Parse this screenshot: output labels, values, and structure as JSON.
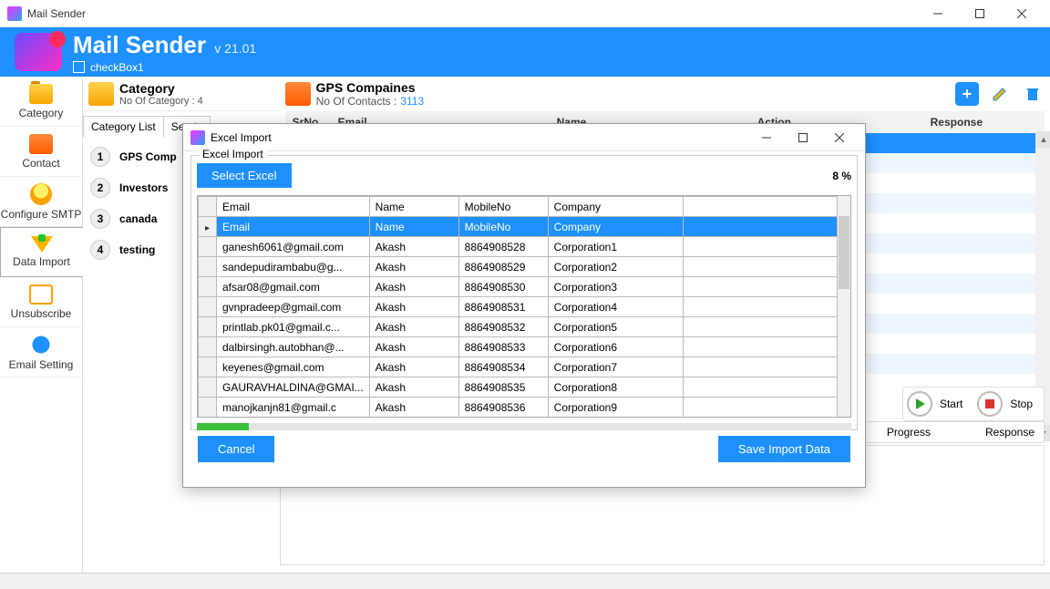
{
  "titlebar": {
    "title": "Mail Sender"
  },
  "header": {
    "brand": "Mail Sender",
    "version": "v 21.01",
    "checkbox_label": "checkBox1"
  },
  "sidenav": {
    "items": [
      {
        "label": "Category"
      },
      {
        "label": "Contact"
      },
      {
        "label": "Configure SMTP"
      },
      {
        "label": "Data Import"
      },
      {
        "label": "Unsubscribe"
      },
      {
        "label": "Email Setting"
      }
    ]
  },
  "midpane": {
    "title": "Category",
    "subtitle": "No Of Category : 4",
    "tabs": [
      {
        "label": "Category List"
      },
      {
        "label": "Sende"
      }
    ],
    "categories": [
      {
        "num": "1",
        "label": "GPS Comp"
      },
      {
        "num": "2",
        "label": "Investors"
      },
      {
        "num": "3",
        "label": "canada"
      },
      {
        "num": "4",
        "label": "testing"
      }
    ]
  },
  "mainpane": {
    "title": "GPS Compaines",
    "subtitle": "No Of Contacts :",
    "count": "3113",
    "cols": {
      "srno": "SrNo",
      "email": "Email",
      "name": "Name",
      "action": "Action",
      "response": "Response"
    },
    "start": "Start",
    "stop": "Stop",
    "progress_col": "Progress",
    "response_col": "Response"
  },
  "modal": {
    "title": "Excel Import",
    "legend": "Excel Import",
    "select_btn": "Select Excel",
    "percent": "8 %",
    "cols": {
      "email": "Email",
      "name": "Name",
      "mobile": "MobileNo",
      "company": "Company"
    },
    "rows": [
      {
        "email": "Email",
        "name": "Name",
        "mobile": "MobileNo",
        "company": "Company"
      },
      {
        "email": "ganesh6061@gmail.com",
        "name": "Akash",
        "mobile": "8864908528",
        "company": "Corporation1"
      },
      {
        "email": "sandepudirambabu@g...",
        "name": "Akash",
        "mobile": "8864908529",
        "company": "Corporation2"
      },
      {
        "email": "afsar08@gmail.com",
        "name": "Akash",
        "mobile": "8864908530",
        "company": "Corporation3"
      },
      {
        "email": "gvnpradeep@gmail.com",
        "name": "Akash",
        "mobile": "8864908531",
        "company": "Corporation4"
      },
      {
        "email": "printlab.pk01@gmail.c...",
        "name": "Akash",
        "mobile": "8864908532",
        "company": "Corporation5"
      },
      {
        "email": "dalbirsingh.autobhan@...",
        "name": "Akash",
        "mobile": "8864908533",
        "company": "Corporation6"
      },
      {
        "email": "keyenes@gmail.com",
        "name": "Akash",
        "mobile": "8864908534",
        "company": "Corporation7"
      },
      {
        "email": "GAURAVHALDINA@GMAI...",
        "name": "Akash",
        "mobile": "8864908535",
        "company": "Corporation8"
      },
      {
        "email": "manojkanjn81@gmail.c",
        "name": "Akash",
        "mobile": "8864908536",
        "company": "Corporation9"
      }
    ],
    "cancel": "Cancel",
    "save": "Save Import Data"
  }
}
